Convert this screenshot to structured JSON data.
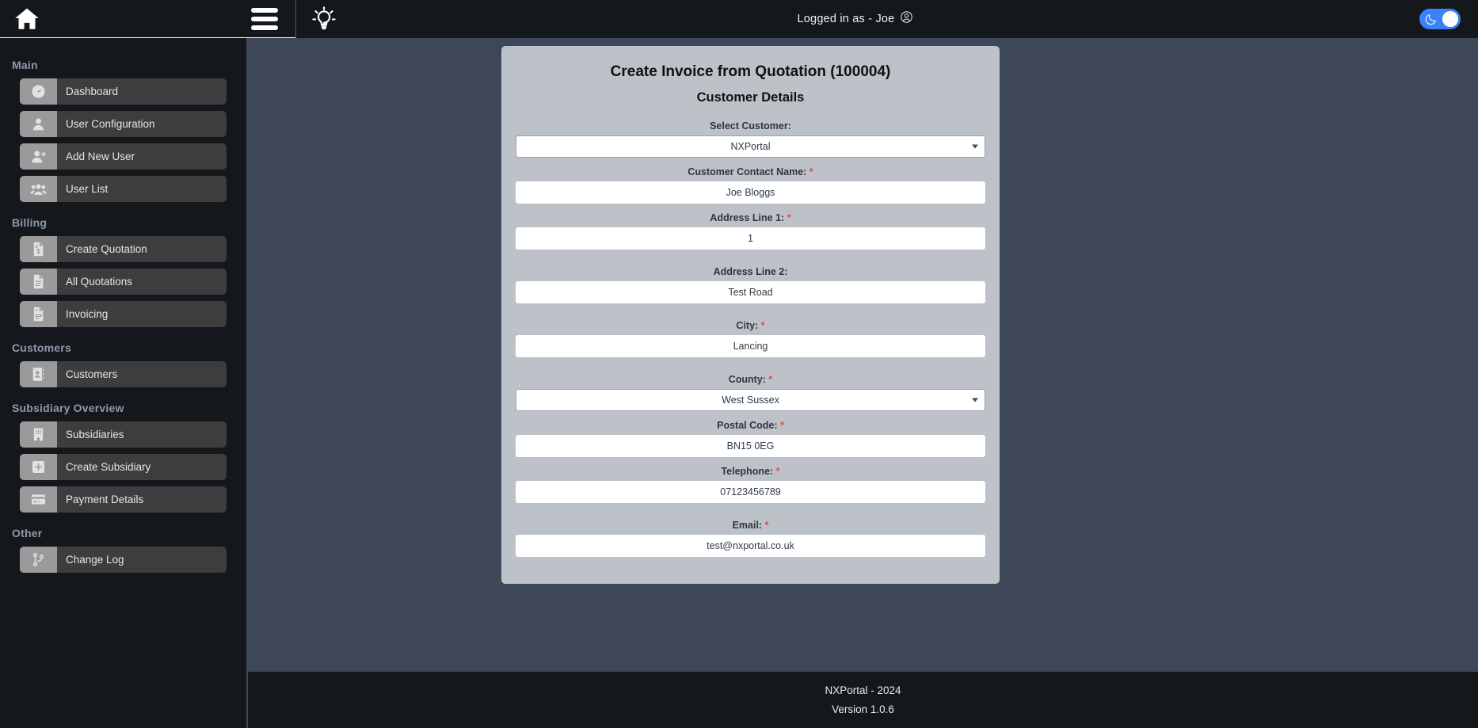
{
  "topbar": {
    "home_icon": "home-icon",
    "menu_icon": "hamburger-menu-icon",
    "bulb_icon": "lightbulb-icon",
    "logged_in_text": "Logged in as - Joe",
    "avatar_icon": "user-circle-icon",
    "theme_toggle": {
      "icon": "moon-icon",
      "state": "on",
      "accent": "#3b82f6"
    }
  },
  "sidebar": {
    "groups": [
      {
        "title": "Main",
        "items": [
          {
            "label": "Dashboard",
            "icon": "gauge-icon"
          },
          {
            "label": "User Configuration",
            "icon": "user-icon"
          },
          {
            "label": "Add New User",
            "icon": "user-plus-icon"
          },
          {
            "label": "User List",
            "icon": "users-group-icon"
          }
        ]
      },
      {
        "title": "Billing",
        "items": [
          {
            "label": "Create Quotation",
            "icon": "document-dollar-icon"
          },
          {
            "label": "All Quotations",
            "icon": "document-lines-icon"
          },
          {
            "label": "Invoicing",
            "icon": "invoice-icon"
          }
        ]
      },
      {
        "title": "Customers",
        "items": [
          {
            "label": "Customers",
            "icon": "address-book-icon"
          }
        ]
      },
      {
        "title": "Subsidiary Overview",
        "items": [
          {
            "label": "Subsidiaries",
            "icon": "building-icon"
          },
          {
            "label": "Create Subsidiary",
            "icon": "plus-square-icon"
          },
          {
            "label": "Payment Details",
            "icon": "credit-card-icon"
          }
        ]
      },
      {
        "title": "Other",
        "items": [
          {
            "label": "Change Log",
            "icon": "git-branch-icon"
          }
        ]
      }
    ]
  },
  "main": {
    "title": "Create Invoice from Quotation (100004)",
    "subtitle": "Customer Details",
    "fields": [
      {
        "label": "Select Customer:",
        "required": false,
        "value": "NXPortal",
        "type": "select",
        "name": "select-customer"
      },
      {
        "label": "Customer Contact Name:",
        "required": true,
        "value": "Joe Bloggs",
        "type": "text",
        "name": "customer-contact-name"
      },
      {
        "label": "Address Line 1:",
        "required": true,
        "value": "1",
        "type": "text",
        "name": "address-line-1"
      },
      {
        "label": "Address Line 2:",
        "required": false,
        "value": "Test Road",
        "type": "text",
        "name": "address-line-2"
      },
      {
        "label": "City:",
        "required": true,
        "value": "Lancing",
        "type": "text",
        "name": "city"
      },
      {
        "label": "County:",
        "required": true,
        "value": "West Sussex",
        "type": "select",
        "name": "county"
      },
      {
        "label": "Postal Code:",
        "required": true,
        "value": "BN15 0EG",
        "type": "text",
        "name": "postal-code"
      },
      {
        "label": "Telephone:",
        "required": true,
        "value": "07123456789",
        "type": "text",
        "name": "telephone"
      },
      {
        "label": "Email:",
        "required": true,
        "value": "test@nxportal.co.uk",
        "type": "text",
        "name": "email"
      }
    ]
  },
  "footer": {
    "line1": "NXPortal - 2024",
    "line2": "Version 1.0.6"
  }
}
